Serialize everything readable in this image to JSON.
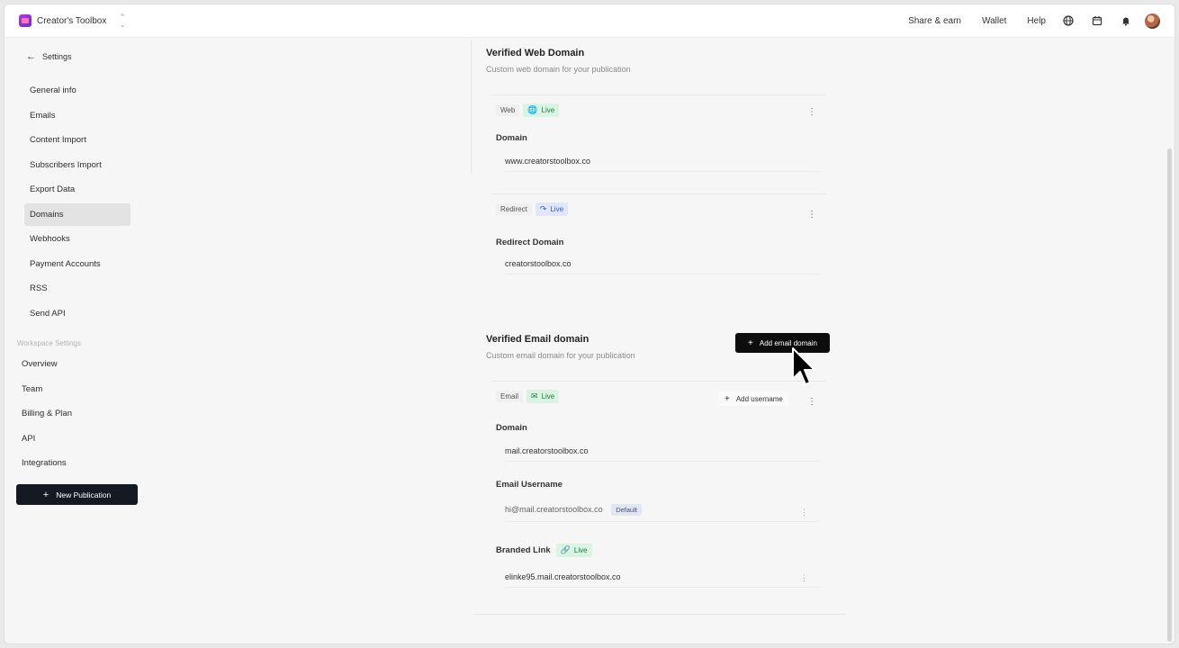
{
  "header": {
    "publication_name": "Creator's Toolbox",
    "links": [
      "Share & earn",
      "Wallet",
      "Help"
    ],
    "icons": [
      "globe-icon",
      "calendar-icon",
      "bell-icon",
      "avatar"
    ]
  },
  "sidebar": {
    "back_label": "Settings",
    "items": [
      {
        "label": "General info"
      },
      {
        "label": "Emails"
      },
      {
        "label": "Content Import"
      },
      {
        "label": "Subscribers Import"
      },
      {
        "label": "Export Data"
      },
      {
        "label": "Domains",
        "active": true
      },
      {
        "label": "Webhooks"
      },
      {
        "label": "Payment Accounts"
      },
      {
        "label": "RSS"
      },
      {
        "label": "Send API"
      }
    ],
    "workspace_label": "Workspace Settings",
    "workspace_items": [
      {
        "label": "Overview"
      },
      {
        "label": "Team"
      },
      {
        "label": "Billing & Plan"
      },
      {
        "label": "API"
      },
      {
        "label": "Integrations"
      }
    ],
    "new_publication_label": "New Publication"
  },
  "web_domain": {
    "title": "Verified Web Domain",
    "subtitle": "Custom web domain for your publication",
    "web_card": {
      "tag": "Web",
      "status": "Live",
      "field_label": "Domain",
      "value": "www.creatorstoolbox.co"
    },
    "redirect_card": {
      "tag": "Redirect",
      "status": "Live",
      "field_label": "Redirect Domain",
      "value": "creatorstoolbox.co"
    }
  },
  "email_domain": {
    "title": "Verified Email domain",
    "subtitle": "Custom email domain for your publication",
    "add_button_label": "Add email domain",
    "card": {
      "tag": "Email",
      "status": "Live",
      "add_username_label": "Add username",
      "domain_label": "Domain",
      "domain_value": "mail.creatorstoolbox.co",
      "username_label": "Email Username",
      "username_value": "hi@mail.creatorstoolbox.co",
      "default_badge": "Default",
      "branded_label": "Branded Link",
      "branded_status": "Live",
      "branded_value": "elinke95.mail.creatorstoolbox.co"
    }
  },
  "colors": {
    "primary_button": "#151a22",
    "live_green_bg": "#d9f4e3",
    "live_blue_bg": "#e1e7fb",
    "active_nav_bg": "#e3e3e3"
  }
}
